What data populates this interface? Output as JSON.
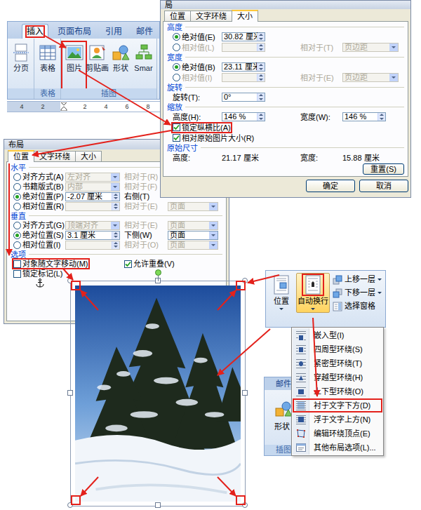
{
  "ribbon": {
    "tabs": [
      {
        "label": "插入",
        "selected": true,
        "marked": true
      },
      {
        "label": "页面布局",
        "selected": false,
        "marked": false
      },
      {
        "label": "引用",
        "selected": false,
        "marked": false
      },
      {
        "label": "邮件",
        "selected": false,
        "marked": false
      }
    ],
    "groups": [
      {
        "buttons": [
          {
            "label": "分页",
            "marked": false
          }
        ]
      },
      {
        "label": "表格",
        "buttons": [
          {
            "label": "表格",
            "marked": false
          }
        ]
      },
      {
        "label": "插图",
        "buttons": [
          {
            "label": "图片",
            "marked": true
          },
          {
            "label": "剪贴画",
            "marked": false
          },
          {
            "label": "形状",
            "marked": false
          },
          {
            "label": "Smar",
            "marked": false
          }
        ]
      }
    ]
  },
  "ruler": {
    "ticks": [
      "4",
      "2",
      "2",
      "4",
      "6",
      "8"
    ]
  },
  "size_dialog": {
    "title": "局",
    "tabs": [
      {
        "label": "位置",
        "selected": false
      },
      {
        "label": "文字环绕",
        "selected": false
      },
      {
        "label": "大小",
        "selected": true
      }
    ],
    "sections": [
      {
        "title": "高度",
        "rows": [
          [
            {
              "kind": "radio",
              "label": "绝对值(E)",
              "selected": true,
              "disabled": false
            },
            {
              "kind": "spin",
              "value": "30.82 厘米",
              "disabled": false
            }
          ],
          [
            {
              "kind": "radio",
              "label": "相对值(L)",
              "selected": false,
              "disabled": true
            },
            {
              "kind": "spin",
              "disabled": true
            },
            {
              "kind": "label",
              "text": "相对于(T)",
              "disabled": true
            },
            {
              "kind": "select",
              "value": "页边距",
              "disabled": true
            }
          ]
        ]
      },
      {
        "title": "宽度",
        "rows": [
          [
            {
              "kind": "radio",
              "label": "绝对值(B)",
              "selected": true,
              "disabled": false
            },
            {
              "kind": "spin",
              "value": "23.11 厘米",
              "disabled": false
            }
          ],
          [
            {
              "kind": "radio",
              "label": "相对值(I)",
              "selected": false,
              "disabled": true
            },
            {
              "kind": "spin",
              "disabled": true
            },
            {
              "kind": "label",
              "text": "相对于(E)",
              "disabled": true
            },
            {
              "kind": "select",
              "value": "页边距",
              "disabled": true
            }
          ]
        ]
      },
      {
        "title": "旋转",
        "rows": [
          [
            {
              "kind": "label",
              "text": "旋转(T):",
              "disabled": false
            },
            {
              "kind": "spin",
              "value": "0°",
              "disabled": false
            }
          ]
        ]
      },
      {
        "title": "缩放",
        "rows": [
          [
            {
              "kind": "label",
              "text": "高度(H):",
              "disabled": false
            },
            {
              "kind": "spin",
              "value": "146 %",
              "disabled": false
            },
            {
              "kind": "label",
              "text": "宽度(W):",
              "disabled": false
            },
            {
              "kind": "spin",
              "value": "146 %",
              "disabled": false
            }
          ],
          [
            {
              "kind": "check",
              "label": "锁定纵横比(A)",
              "checked": true,
              "marked": true,
              "disabled": false
            }
          ],
          [
            {
              "kind": "check",
              "label": "相对原始图片大小(R)",
              "checked": true,
              "marked": false,
              "disabled": false
            }
          ]
        ]
      },
      {
        "title": "原始尺寸",
        "rows": [
          [
            {
              "kind": "label",
              "text": "高度:",
              "disabled": false
            },
            {
              "kind": "label",
              "text": "21.17 厘米",
              "disabled": false
            },
            {
              "kind": "label",
              "text": "宽度:",
              "disabled": false
            },
            {
              "kind": "label",
              "text": "15.88 厘米",
              "disabled": false
            }
          ]
        ]
      }
    ],
    "reset": "重置(S)",
    "buttons": [
      "确定",
      "取消"
    ]
  },
  "layout_dialog": {
    "title": "布局",
    "tabs": [
      {
        "label": "位置",
        "selected": true
      },
      {
        "label": "文字环绕",
        "selected": false
      },
      {
        "label": "大小",
        "selected": false
      }
    ],
    "sections": [
      {
        "title": "水平",
        "rows": [
          [
            {
              "kind": "radio",
              "label": "对齐方式(A)",
              "selected": false,
              "disabled": false
            },
            {
              "kind": "select",
              "value": "左对齐",
              "disabled": true
            },
            {
              "kind": "label",
              "text": "相对于(R)",
              "disabled": true
            }
          ],
          [
            {
              "kind": "radio",
              "label": "书籍版式(B)",
              "selected": false,
              "disabled": false
            },
            {
              "kind": "select",
              "value": "内部",
              "disabled": true
            },
            {
              "kind": "label",
              "text": "相对于(F)",
              "disabled": true
            }
          ],
          [
            {
              "kind": "radio",
              "label": "绝对位置(P)",
              "selected": true,
              "disabled": false
            },
            {
              "kind": "spin",
              "value": "-2.07 厘米",
              "disabled": false
            },
            {
              "kind": "label",
              "text": "右侧(T)",
              "disabled": false
            }
          ],
          [
            {
              "kind": "radio",
              "label": "相对位置(R)",
              "selected": false,
              "disabled": false
            },
            {
              "kind": "spin",
              "disabled": true
            },
            {
              "kind": "label",
              "text": "相对于(E)",
              "disabled": true
            },
            {
              "kind": "select",
              "value": "页面",
              "disabled": true
            }
          ]
        ]
      },
      {
        "title": "垂直",
        "rows": [
          [
            {
              "kind": "radio",
              "label": "对齐方式(G)",
              "selected": false,
              "disabled": false
            },
            {
              "kind": "select",
              "value": "顶端对齐",
              "disabled": true
            },
            {
              "kind": "label",
              "text": "相对于(E)",
              "disabled": true
            },
            {
              "kind": "select",
              "value": "页面",
              "disabled": true
            }
          ],
          [
            {
              "kind": "radio",
              "label": "绝对位置(S)",
              "selected": true,
              "disabled": false
            },
            {
              "kind": "spin",
              "value": "3.1 厘米",
              "disabled": false
            },
            {
              "kind": "label",
              "text": "下侧(W)",
              "disabled": false
            },
            {
              "kind": "select",
              "value": "页面",
              "disabled": false
            }
          ],
          [
            {
              "kind": "radio",
              "label": "相对位置(I)",
              "selected": false,
              "disabled": false
            },
            {
              "kind": "spin",
              "disabled": true
            },
            {
              "kind": "label",
              "text": "相对于(O)",
              "disabled": true
            },
            {
              "kind": "select",
              "value": "页面",
              "disabled": true
            }
          ]
        ]
      },
      {
        "title": "选项",
        "rows": [
          [
            {
              "kind": "check",
              "label": "对象随文字移动(M)",
              "checked": false,
              "marked": true,
              "disabled": false
            },
            {
              "kind": "check",
              "label": "允许重叠(V)",
              "checked": true,
              "marked": false,
              "disabled": false
            }
          ],
          [
            {
              "kind": "check",
              "label": "锁定标记(L)",
              "checked": false,
              "marked": false,
              "disabled": false
            }
          ]
        ]
      }
    ]
  },
  "arrange": {
    "buttons": [
      {
        "label": "位置",
        "pressed": false,
        "marked": false
      },
      {
        "label": "自动换行",
        "pressed": true,
        "marked": true
      }
    ],
    "small_buttons": [
      {
        "label": "上移一层",
        "dropdown": true
      },
      {
        "label": "下移一层",
        "dropdown": true
      },
      {
        "label": "选择窗格",
        "dropdown": false
      }
    ],
    "menu": [
      {
        "label": "嵌入型(I)",
        "marked": false
      },
      {
        "label": "四周型环绕(S)",
        "marked": false
      },
      {
        "label": "紧密型环绕(T)",
        "marked": false
      },
      {
        "label": "穿越型环绕(H)",
        "marked": false
      },
      {
        "label": "上下型环绕(O)",
        "marked": false
      },
      {
        "label": "衬于文字下方(D)",
        "marked": true
      },
      {
        "label": "浮于文字上方(N)",
        "marked": false
      },
      {
        "label": "编辑环绕顶点(E)",
        "marked": false
      },
      {
        "label": "其他布局选项(L)...",
        "marked": false
      }
    ]
  },
  "ribbon_behind": {
    "tab": "邮件",
    "button": "形状",
    "group": "插图"
  },
  "photo": {
    "selected": true
  }
}
